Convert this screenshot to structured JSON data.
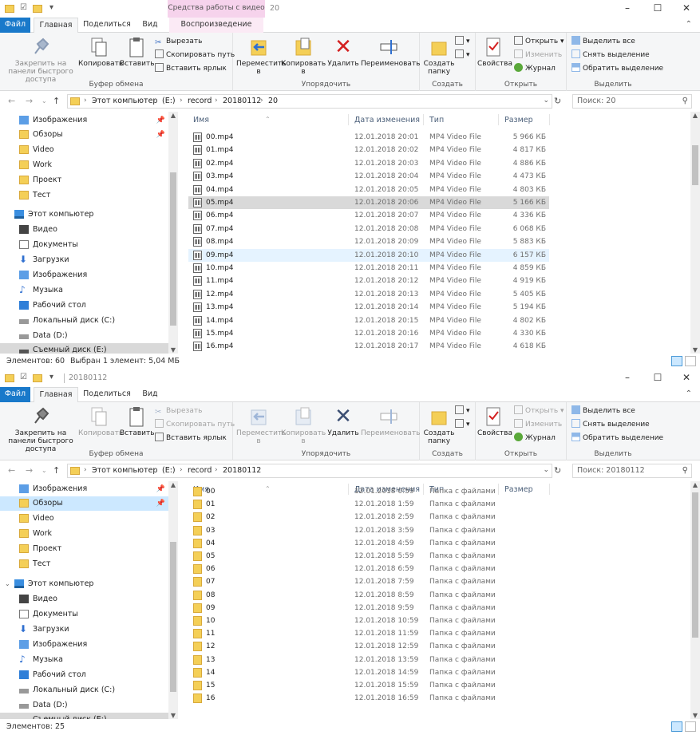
{
  "windows": [
    {
      "title": "20",
      "contextual_tab": "Средства работы с видео",
      "tabs": [
        "Файл",
        "Главная",
        "Поделиться",
        "Вид",
        "Воспроизведение"
      ],
      "ribbon": {
        "clipboard": {
          "label": "Буфер обмена",
          "pin": "Закрепить на панели быстрого доступа",
          "copy": "Копировать",
          "paste": "Вставить",
          "cut": "Вырезать",
          "copy_path": "Скопировать путь",
          "paste_shortcut": "Вставить ярлык"
        },
        "organize": {
          "label": "Упорядочить",
          "move": "Переместить в",
          "copy_to": "Копировать в",
          "delete": "Удалить",
          "rename": "Переименовать"
        },
        "new": {
          "label": "Создать",
          "new_folder": "Создать папку"
        },
        "open": {
          "label": "Открыть",
          "properties": "Свойства",
          "open": "Открыть",
          "edit": "Изменить",
          "history": "Журнал"
        },
        "select": {
          "label": "Выделить",
          "select_all": "Выделить все",
          "select_none": "Снять выделение",
          "invert": "Обратить выделение"
        }
      },
      "address": {
        "crumbs": [
          "Этот компьютер",
          "(E:)",
          "record",
          "20180112",
          "20"
        ],
        "search_placeholder": "Поиск: 20"
      },
      "nav": [
        "Изображения",
        "Обзоры",
        "Video",
        "Work",
        "Проект",
        "Тест",
        "Этот компьютер",
        "Видео",
        "Документы",
        "Загрузки",
        "Изображения",
        "Музыка",
        "Рабочий стол",
        "Локальный диск (C:)",
        "Data (D:)",
        "Съемный диск (E:)"
      ],
      "columns": [
        "Имя",
        "Дата изменения",
        "Тип",
        "Размер"
      ],
      "files": [
        [
          "00.mp4",
          "12.01.2018 20:01",
          "MP4 Video File",
          "5 966 КБ"
        ],
        [
          "01.mp4",
          "12.01.2018 20:02",
          "MP4 Video File",
          "4 817 КБ"
        ],
        [
          "02.mp4",
          "12.01.2018 20:03",
          "MP4 Video File",
          "4 886 КБ"
        ],
        [
          "03.mp4",
          "12.01.2018 20:04",
          "MP4 Video File",
          "4 473 КБ"
        ],
        [
          "04.mp4",
          "12.01.2018 20:05",
          "MP4 Video File",
          "4 803 КБ"
        ],
        [
          "05.mp4",
          "12.01.2018 20:06",
          "MP4 Video File",
          "5 166 КБ"
        ],
        [
          "06.mp4",
          "12.01.2018 20:07",
          "MP4 Video File",
          "4 336 КБ"
        ],
        [
          "07.mp4",
          "12.01.2018 20:08",
          "MP4 Video File",
          "6 068 КБ"
        ],
        [
          "08.mp4",
          "12.01.2018 20:09",
          "MP4 Video File",
          "5 883 КБ"
        ],
        [
          "09.mp4",
          "12.01.2018 20:10",
          "MP4 Video File",
          "6 157 КБ"
        ],
        [
          "10.mp4",
          "12.01.2018 20:11",
          "MP4 Video File",
          "4 859 КБ"
        ],
        [
          "11.mp4",
          "12.01.2018 20:12",
          "MP4 Video File",
          "4 919 КБ"
        ],
        [
          "12.mp4",
          "12.01.2018 20:13",
          "MP4 Video File",
          "5 405 КБ"
        ],
        [
          "13.mp4",
          "12.01.2018 20:14",
          "MP4 Video File",
          "5 194 КБ"
        ],
        [
          "14.mp4",
          "12.01.2018 20:15",
          "MP4 Video File",
          "4 802 КБ"
        ],
        [
          "15.mp4",
          "12.01.2018 20:16",
          "MP4 Video File",
          "4 330 КБ"
        ],
        [
          "16.mp4",
          "12.01.2018 20:17",
          "MP4 Video File",
          "4 618 КБ"
        ]
      ],
      "status": {
        "count": "Элементов: 60",
        "selected": "Выбран 1 элемент: 5,04 МБ"
      }
    },
    {
      "title": "20180112",
      "tabs": [
        "Файл",
        "Главная",
        "Поделиться",
        "Вид"
      ],
      "ribbon": {
        "clipboard": {
          "label": "Буфер обмена",
          "pin": "Закрепить на панели быстрого доступа",
          "copy": "Копировать",
          "paste": "Вставить",
          "cut": "Вырезать",
          "copy_path": "Скопировать путь",
          "paste_shortcut": "Вставить ярлык"
        },
        "organize": {
          "label": "Упорядочить",
          "move": "Переместить в",
          "copy_to": "Копировать в",
          "delete": "Удалить",
          "rename": "Переименовать"
        },
        "new": {
          "label": "Создать",
          "new_folder": "Создать папку"
        },
        "open": {
          "label": "Открыть",
          "properties": "Свойства",
          "open": "Открыть",
          "edit": "Изменить",
          "history": "Журнал"
        },
        "select": {
          "label": "Выделить",
          "select_all": "Выделить все",
          "select_none": "Снять выделение",
          "invert": "Обратить выделение"
        }
      },
      "address": {
        "crumbs": [
          "Этот компьютер",
          "(E:)",
          "record",
          "20180112"
        ],
        "search_placeholder": "Поиск: 20180112"
      },
      "nav": [
        "Изображения",
        "Обзоры",
        "Video",
        "Work",
        "Проект",
        "Тест",
        "Этот компьютер",
        "Видео",
        "Документы",
        "Загрузки",
        "Изображения",
        "Музыка",
        "Рабочий стол",
        "Локальный диск (C:)",
        "Data (D:)",
        "Съемный диск (E:)"
      ],
      "columns": [
        "Имя",
        "Дата изменения",
        "Тип",
        "Размер"
      ],
      "files": [
        [
          "00",
          "12.01.2018 0:59",
          "Папка с файлами",
          ""
        ],
        [
          "01",
          "12.01.2018 1:59",
          "Папка с файлами",
          ""
        ],
        [
          "02",
          "12.01.2018 2:59",
          "Папка с файлами",
          ""
        ],
        [
          "03",
          "12.01.2018 3:59",
          "Папка с файлами",
          ""
        ],
        [
          "04",
          "12.01.2018 4:59",
          "Папка с файлами",
          ""
        ],
        [
          "05",
          "12.01.2018 5:59",
          "Папка с файлами",
          ""
        ],
        [
          "06",
          "12.01.2018 6:59",
          "Папка с файлами",
          ""
        ],
        [
          "07",
          "12.01.2018 7:59",
          "Папка с файлами",
          ""
        ],
        [
          "08",
          "12.01.2018 8:59",
          "Папка с файлами",
          ""
        ],
        [
          "09",
          "12.01.2018 9:59",
          "Папка с файлами",
          ""
        ],
        [
          "10",
          "12.01.2018 10:59",
          "Папка с файлами",
          ""
        ],
        [
          "11",
          "12.01.2018 11:59",
          "Папка с файлами",
          ""
        ],
        [
          "12",
          "12.01.2018 12:59",
          "Папка с файлами",
          ""
        ],
        [
          "13",
          "12.01.2018 13:59",
          "Папка с файлами",
          ""
        ],
        [
          "14",
          "12.01.2018 14:59",
          "Папка с файлами",
          ""
        ],
        [
          "15",
          "12.01.2018 15:59",
          "Папка с файлами",
          ""
        ],
        [
          "16",
          "12.01.2018 16:59",
          "Папка с файлами",
          ""
        ]
      ],
      "status": {
        "count": "Элементов: 25",
        "selected": ""
      }
    }
  ]
}
